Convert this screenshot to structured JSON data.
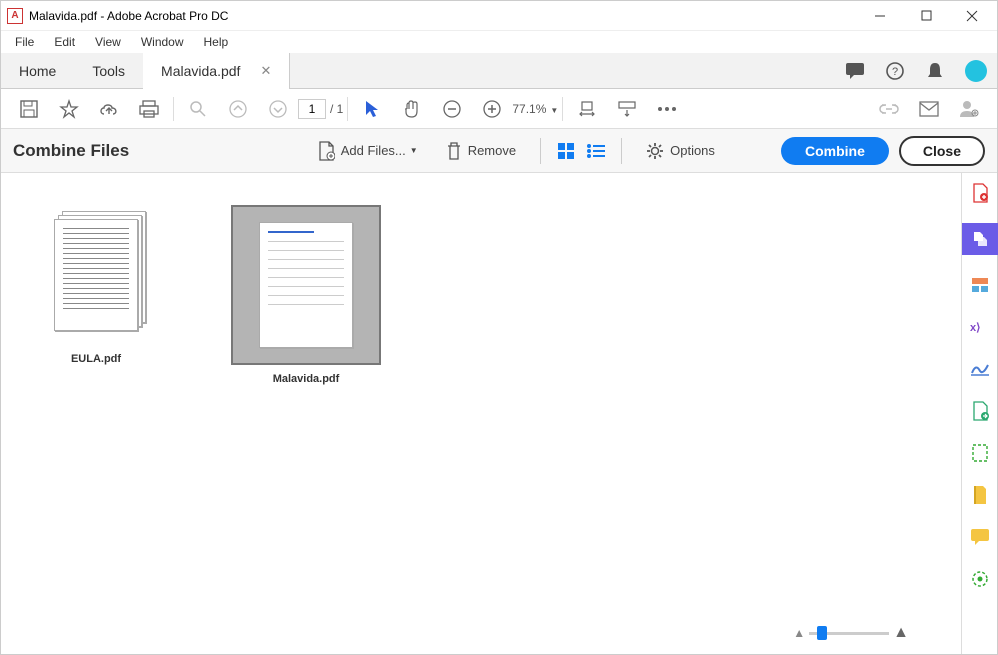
{
  "window": {
    "title": "Malavida.pdf - Adobe Acrobat Pro DC"
  },
  "menu": {
    "file": "File",
    "edit": "Edit",
    "view": "View",
    "window": "Window",
    "help": "Help"
  },
  "tabs": {
    "home": "Home",
    "tools": "Tools",
    "doc": "Malavida.pdf"
  },
  "toolbar": {
    "page_current": "1",
    "page_total": "/  1",
    "zoom": "77.1%"
  },
  "combine": {
    "title": "Combine Files",
    "add_files": "Add Files...",
    "remove": "Remove",
    "options": "Options",
    "combine_btn": "Combine",
    "close_btn": "Close"
  },
  "files": [
    {
      "name": "EULA.pdf"
    },
    {
      "name": "Malavida.pdf"
    }
  ]
}
